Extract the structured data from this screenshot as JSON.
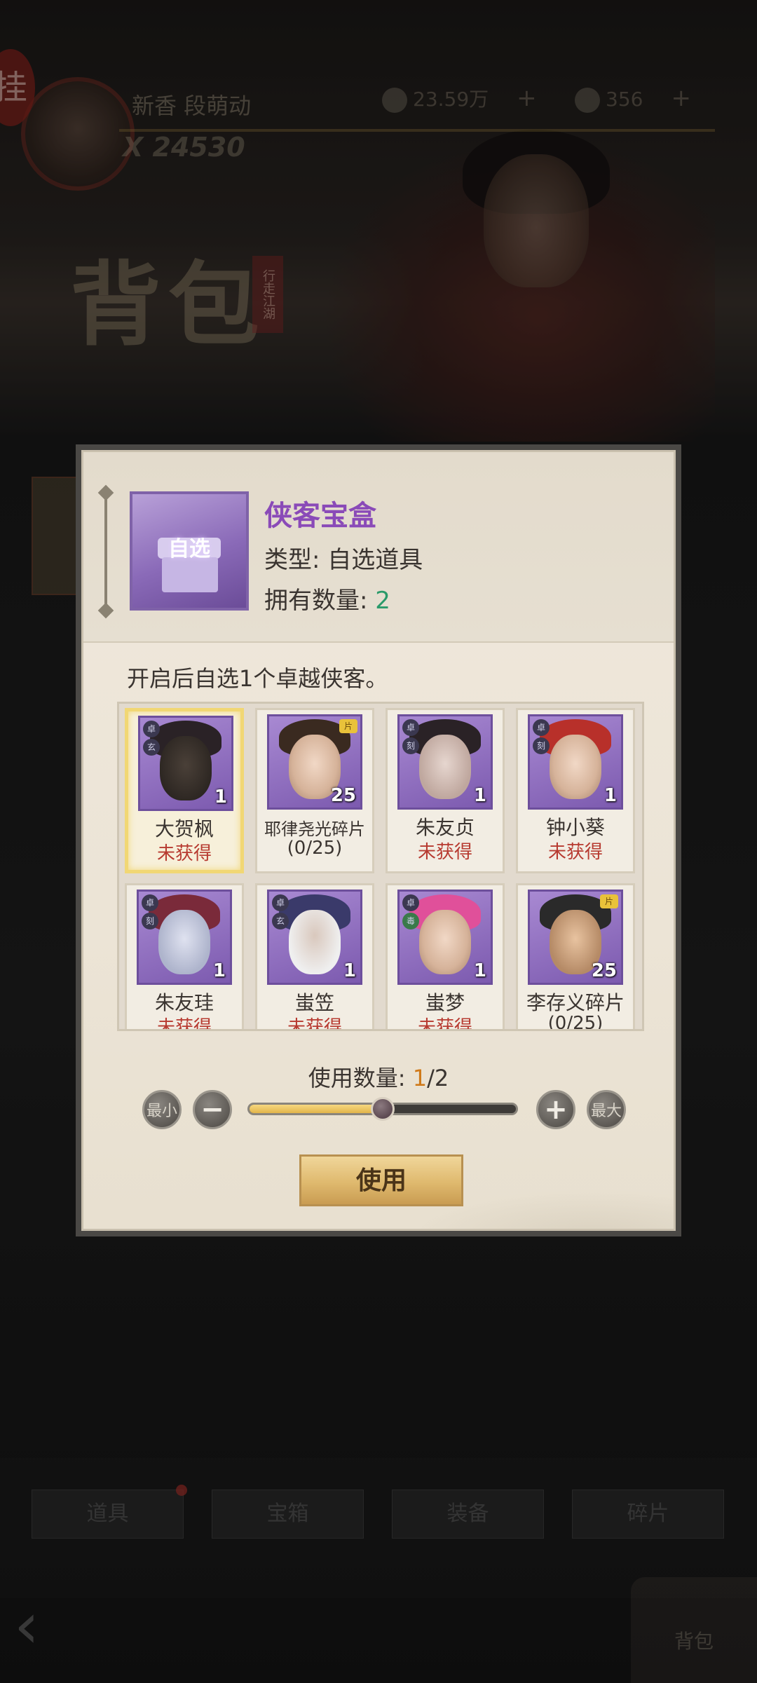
{
  "background": {
    "player_name": "新香  段萌动",
    "power": "X 24530",
    "calligraphy": "背包",
    "seal_text": "行走江湖",
    "char_mark": "挂",
    "resources": [
      {
        "value": "23.59万"
      },
      {
        "value": "356"
      }
    ],
    "plus": "+",
    "tabs": [
      "道具",
      "宝箱",
      "装备",
      "碎片"
    ],
    "back_glyph": "‹",
    "bag_label": "背包"
  },
  "dialog": {
    "item": {
      "icon_label": "自选",
      "title": "侠客宝盒",
      "type_text": "类型: 自选道具",
      "count_label": "拥有数量: ",
      "count_value": "2"
    },
    "description": "开启后自选1个卓越侠客。",
    "cards": [
      {
        "name": "大贺枫",
        "status": "未获得",
        "count": "1",
        "selected": true
      },
      {
        "name": "耶律尧光碎片",
        "status": "(0/25)",
        "count": "25"
      },
      {
        "name": "朱友贞",
        "status": "未获得",
        "count": "1"
      },
      {
        "name": "钟小葵",
        "status": "未获得",
        "count": "1"
      },
      {
        "name": "朱友珪",
        "status": "未获得",
        "count": "1"
      },
      {
        "name": "蚩笠",
        "status": "未获得",
        "count": "1"
      },
      {
        "name": "蚩梦",
        "status": "未获得",
        "count": "1"
      },
      {
        "name": "李存义碎片",
        "status": "(0/25)",
        "count": "25"
      }
    ],
    "quantity": {
      "label": "使用数量: ",
      "current": "1",
      "total": "/2",
      "fraction": 0.5
    },
    "buttons": {
      "min": "最小",
      "minus": "−",
      "plus": "+",
      "max": "最大",
      "use": "使用"
    }
  }
}
